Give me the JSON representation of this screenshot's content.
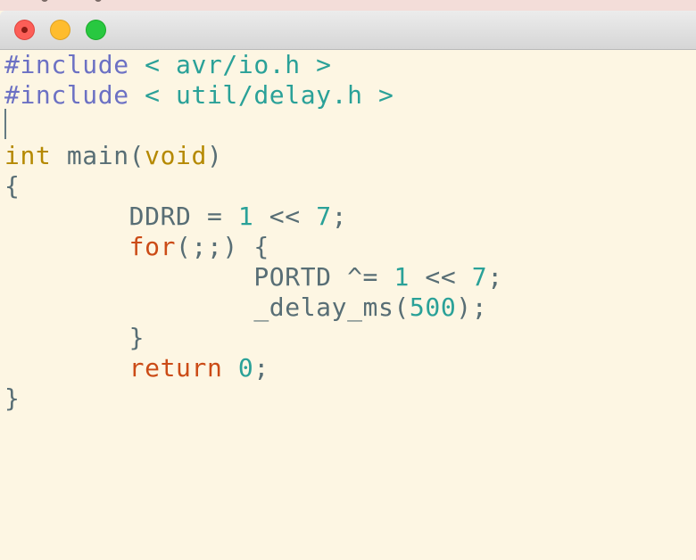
{
  "window": {
    "buttons": {
      "close": "close-button",
      "minimize": "minimize-button",
      "zoom": "zoom-button"
    },
    "colors": {
      "close": "#fc5e57",
      "minimize": "#febc2e",
      "zoom": "#28c840"
    }
  },
  "editor": {
    "theme_colors": {
      "background": "#fdf6e3",
      "text": "#586e75",
      "preprocessor": "#6c71c4",
      "string_number": "#2aa198",
      "type": "#b58900",
      "keyword": "#cb4b16"
    },
    "lines": [
      {
        "tokens": [
          {
            "t": "#include",
            "c": "pre"
          },
          {
            "t": " < avr/io.h >",
            "c": "cyan"
          }
        ]
      },
      {
        "tokens": [
          {
            "t": "#include",
            "c": "pre"
          },
          {
            "t": " < util/delay.h >",
            "c": "cyan"
          }
        ]
      },
      {
        "tokens": []
      },
      {
        "tokens": [
          {
            "t": "int",
            "c": "type"
          },
          {
            "t": " main(",
            "c": "plain"
          },
          {
            "t": "void",
            "c": "type"
          },
          {
            "t": ")",
            "c": "plain"
          }
        ]
      },
      {
        "tokens": [
          {
            "t": "{",
            "c": "plain"
          }
        ]
      },
      {
        "tokens": [
          {
            "t": "        DDRD = ",
            "c": "plain"
          },
          {
            "t": "1",
            "c": "cyan"
          },
          {
            "t": " << ",
            "c": "plain"
          },
          {
            "t": "7",
            "c": "cyan"
          },
          {
            "t": ";",
            "c": "plain"
          }
        ]
      },
      {
        "tokens": [
          {
            "t": "        ",
            "c": "plain"
          },
          {
            "t": "for",
            "c": "kw"
          },
          {
            "t": "(;;) {",
            "c": "plain"
          }
        ]
      },
      {
        "tokens": [
          {
            "t": "                PORTD ^= ",
            "c": "plain"
          },
          {
            "t": "1",
            "c": "cyan"
          },
          {
            "t": " << ",
            "c": "plain"
          },
          {
            "t": "7",
            "c": "cyan"
          },
          {
            "t": ";",
            "c": "plain"
          }
        ]
      },
      {
        "tokens": [
          {
            "t": "                _delay_ms(",
            "c": "plain"
          },
          {
            "t": "500",
            "c": "cyan"
          },
          {
            "t": ");",
            "c": "plain"
          }
        ]
      },
      {
        "tokens": [
          {
            "t": "        }",
            "c": "plain"
          }
        ]
      },
      {
        "tokens": [
          {
            "t": "        ",
            "c": "plain"
          },
          {
            "t": "return",
            "c": "kw"
          },
          {
            "t": " ",
            "c": "plain"
          },
          {
            "t": "0",
            "c": "cyan"
          },
          {
            "t": ";",
            "c": "plain"
          }
        ]
      },
      {
        "tokens": [
          {
            "t": "}",
            "c": "plain"
          }
        ]
      }
    ]
  }
}
